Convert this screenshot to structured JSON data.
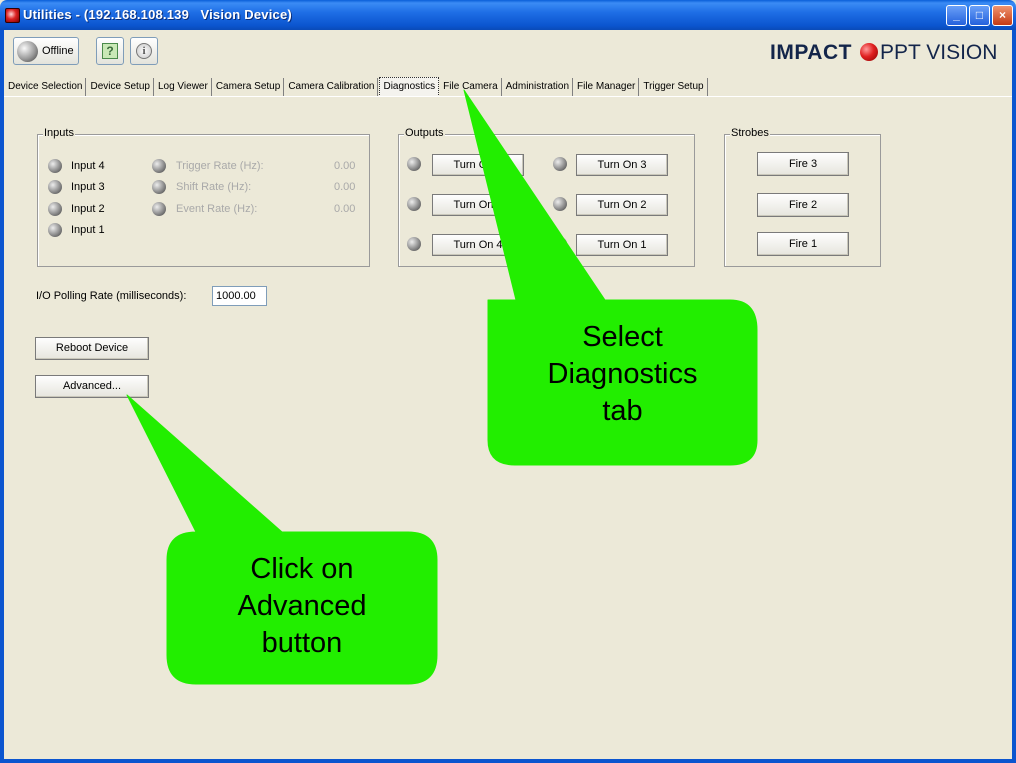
{
  "window": {
    "title": "Utilities - (192.168.108.139   Vision Device)",
    "controls": {
      "minimize": "_",
      "maximize": "□",
      "close": "×"
    }
  },
  "toolbar": {
    "offline_label": "Offline",
    "help_glyph": "?",
    "info_glyph": "i"
  },
  "logo": {
    "impact": "IMPACT",
    "ppt": "PPT VISION"
  },
  "tabs": [
    {
      "label": "Device Selection",
      "active": false
    },
    {
      "label": "Device Setup",
      "active": false
    },
    {
      "label": "Log Viewer",
      "active": false
    },
    {
      "label": "Camera Setup",
      "active": false
    },
    {
      "label": "Camera Calibration",
      "active": false
    },
    {
      "label": "Diagnostics",
      "active": true
    },
    {
      "label": "File Camera",
      "active": false
    },
    {
      "label": "Administration",
      "active": false
    },
    {
      "label": "File Manager",
      "active": false
    },
    {
      "label": "Trigger Setup",
      "active": false
    }
  ],
  "inputs": {
    "title": "Inputs",
    "items": [
      "Input 4",
      "Input 3",
      "Input 2",
      "Input 1"
    ],
    "rates": [
      {
        "label": "Trigger Rate (Hz):",
        "value": "0.00"
      },
      {
        "label": "Shift Rate (Hz):",
        "value": "0.00"
      },
      {
        "label": "Event Rate (Hz):",
        "value": "0.00"
      }
    ]
  },
  "outputs": {
    "title": "Outputs",
    "left_buttons": [
      "Turn On 6",
      "Turn On 5",
      "Turn On 4"
    ],
    "right_buttons": [
      "Turn On 3",
      "Turn On 2",
      "Turn On 1"
    ]
  },
  "strobes": {
    "title": "Strobes",
    "buttons": [
      "Fire 3",
      "Fire 2",
      "Fire 1"
    ]
  },
  "polling": {
    "label": "I/O Polling Rate (milliseconds):",
    "value": "1000.00"
  },
  "actions": {
    "reboot": "Reboot Device",
    "advanced": "Advanced..."
  },
  "callouts": {
    "diagnostics": [
      "Select",
      "Diagnostics",
      "tab"
    ],
    "advanced": [
      "Click on",
      "Advanced",
      "button"
    ],
    "color": "#22ee00"
  }
}
